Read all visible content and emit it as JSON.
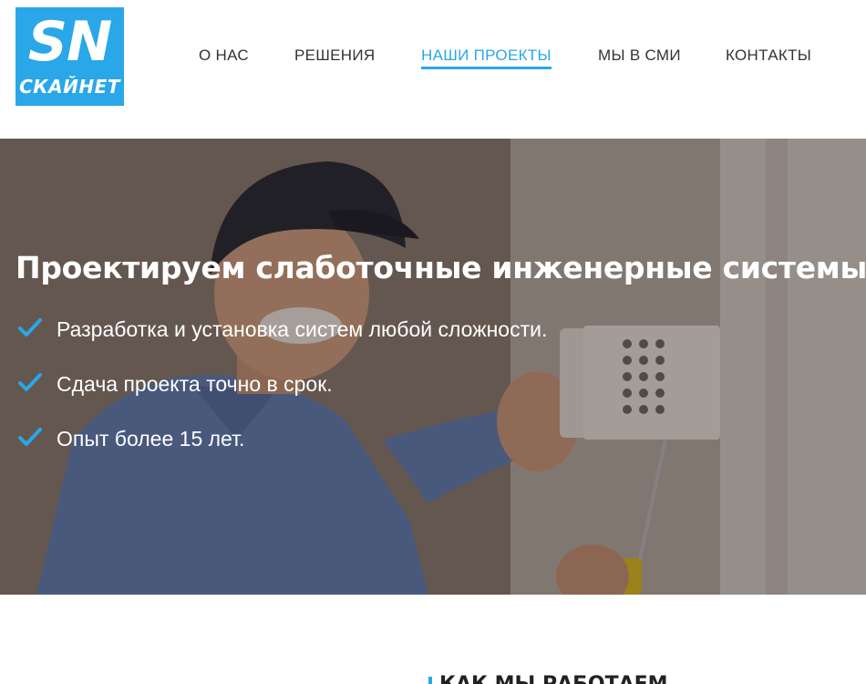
{
  "logo": {
    "main": "SN",
    "sub": "СКАЙНЕТ"
  },
  "nav": {
    "items": [
      {
        "label": "О НАС"
      },
      {
        "label": "РЕШЕНИЯ"
      },
      {
        "label": "НАШИ ПРОЕКТЫ",
        "active": true
      },
      {
        "label": "МЫ В СМИ"
      },
      {
        "label": "КОНТАКТЫ"
      }
    ]
  },
  "hero": {
    "title": "Проектируем слаботочные инженерные системы",
    "bullets": [
      "Разработка и установка систем любой сложности.",
      "Сдача проекта точно в срок.",
      "Опыт более 15 лет."
    ]
  },
  "section": {
    "title": "КАК МЫ РАБОТАЕМ"
  },
  "colors": {
    "accent": "#2aa7e8",
    "text": "#333333",
    "hero_text": "#ffffff"
  }
}
